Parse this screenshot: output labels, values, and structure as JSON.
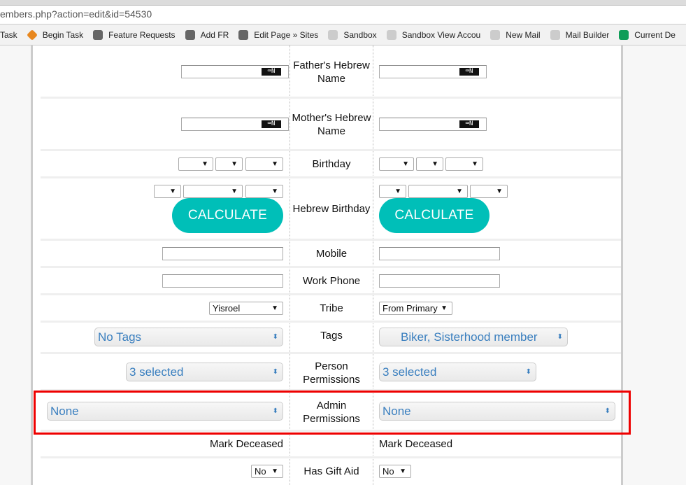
{
  "browser": {
    "url": "embers.php?action=edit&id=54530",
    "bookmarks": [
      {
        "label": "Task",
        "icon": "task-icon"
      },
      {
        "label": "Begin Task",
        "icon": "diamond-icon",
        "color": "#e8871e"
      },
      {
        "label": "Feature Requests",
        "icon": "cloud-icon"
      },
      {
        "label": "Add FR",
        "icon": "cloud-icon"
      },
      {
        "label": "Edit Page » Sites",
        "icon": "cloud-icon"
      },
      {
        "label": "Sandbox",
        "icon": "tree-icon"
      },
      {
        "label": "Sandbox View Accou",
        "icon": "tree-icon"
      },
      {
        "label": "New Mail",
        "icon": "tree-icon"
      },
      {
        "label": "Mail Builder",
        "icon": "tree-icon"
      },
      {
        "label": "Current De",
        "icon": "sheets-icon",
        "color": "#0f9d58"
      }
    ]
  },
  "form": {
    "fathers_hebrew_name": {
      "label": "Father's Hebrew Name",
      "left": "",
      "right": ""
    },
    "mothers_hebrew_name": {
      "label": "Mother's Hebrew Name",
      "left": "",
      "right": ""
    },
    "keyboard_badge": "⌨N",
    "birthday": {
      "label": "Birthday"
    },
    "hebrew_birthday": {
      "label": "Hebrew Birthday",
      "calculate": "CALCULATE"
    },
    "mobile": {
      "label": "Mobile",
      "left": "",
      "right": ""
    },
    "work_phone": {
      "label": "Work Phone",
      "left": "",
      "right": ""
    },
    "tribe": {
      "label": "Tribe",
      "left": "Yisroel",
      "right": "From Primary"
    },
    "tags": {
      "label": "Tags",
      "left": "No Tags",
      "right": "Biker, Sisterhood member"
    },
    "person_permissions": {
      "label": "Person Permissions",
      "left": "3 selected",
      "right": "3 selected"
    },
    "admin_permissions": {
      "label": "Admin Permissions",
      "left": "None",
      "right": "None"
    },
    "mark_deceased": {
      "left": "Mark Deceased",
      "right": "Mark Deceased"
    },
    "gift_aid": {
      "label": "Has Gift Aid",
      "left": "No",
      "right": "No"
    }
  },
  "colors": {
    "accent": "#00bfb8",
    "highlight": "#e00000",
    "select_text": "#3a7fbf"
  }
}
